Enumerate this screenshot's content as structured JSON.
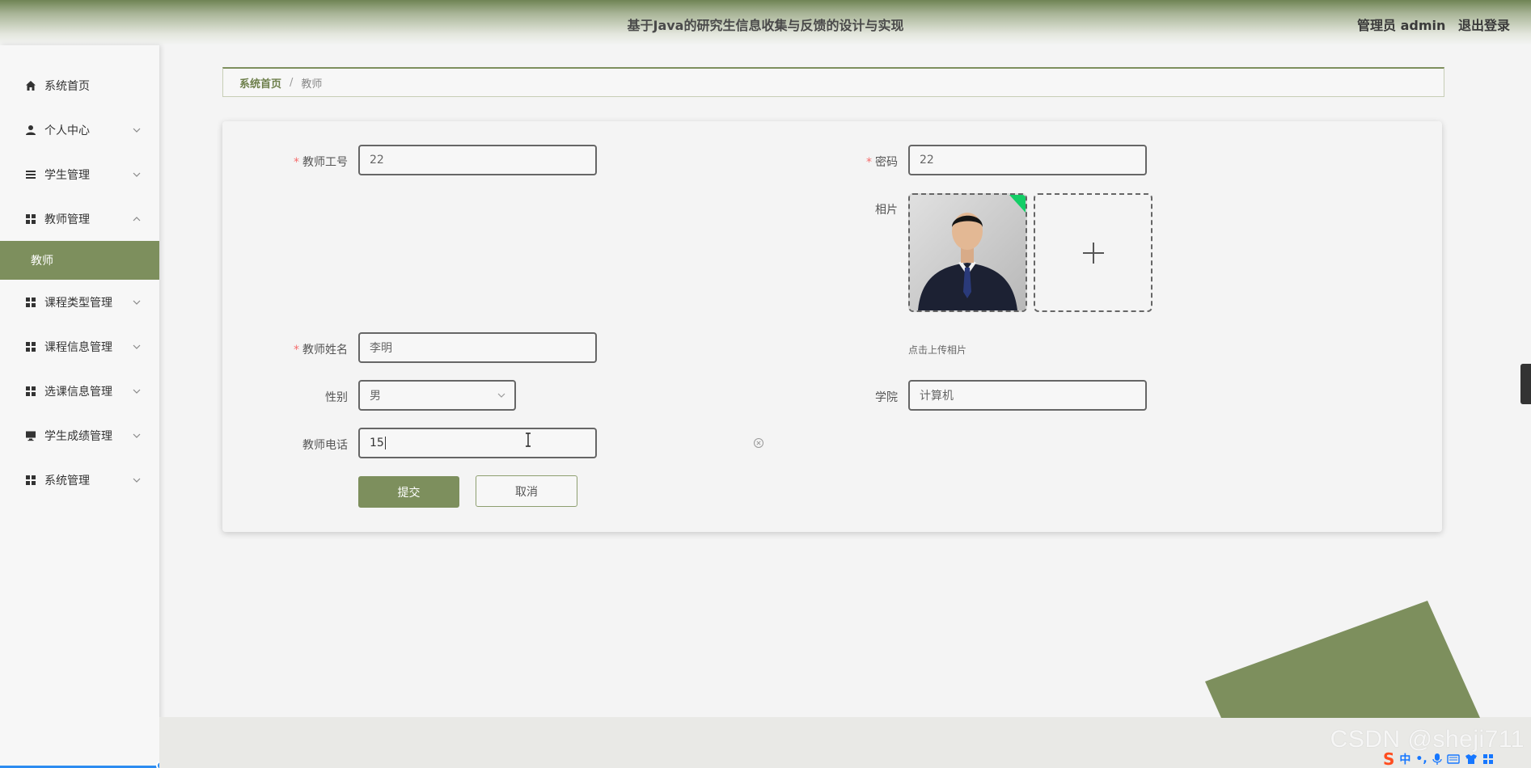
{
  "header": {
    "title": "基于Java的研究生信息收集与反馈的设计与实现",
    "user_label": "管理员 admin",
    "logout_label": "退出登录"
  },
  "sidebar": {
    "items": [
      {
        "label": "系统首页",
        "icon": "home-icon"
      },
      {
        "label": "个人中心",
        "icon": "user-icon"
      },
      {
        "label": "学生管理",
        "icon": "list-icon"
      },
      {
        "label": "教师管理",
        "icon": "grid-icon"
      },
      {
        "label": "课程类型管理",
        "icon": "grid-icon"
      },
      {
        "label": "课程信息管理",
        "icon": "grid-icon"
      },
      {
        "label": "选课信息管理",
        "icon": "grid-icon"
      },
      {
        "label": "学生成绩管理",
        "icon": "monitor-icon"
      },
      {
        "label": "系统管理",
        "icon": "grid-icon"
      }
    ],
    "active_sub": "教师"
  },
  "breadcrumb": {
    "home": "系统首页",
    "separator": "/",
    "current": "教师"
  },
  "form": {
    "teacher_id": {
      "label": "教师工号",
      "value": "22"
    },
    "password": {
      "label": "密码",
      "value": "22"
    },
    "photo": {
      "label": "相片",
      "hint": "点击上传相片"
    },
    "teacher_name": {
      "label": "教师姓名",
      "value": "李明"
    },
    "gender": {
      "label": "性别",
      "value": "男"
    },
    "college": {
      "label": "学院",
      "value": "计算机"
    },
    "phone": {
      "label": "教师电话",
      "value": "15"
    },
    "submit_label": "提交",
    "cancel_label": "取消",
    "required_mark": "*"
  },
  "watermark": "CSDN @sheji711",
  "ime": {
    "lang": "中"
  },
  "colors": {
    "accent": "#7d8f5d",
    "required": "#f56c6c"
  }
}
